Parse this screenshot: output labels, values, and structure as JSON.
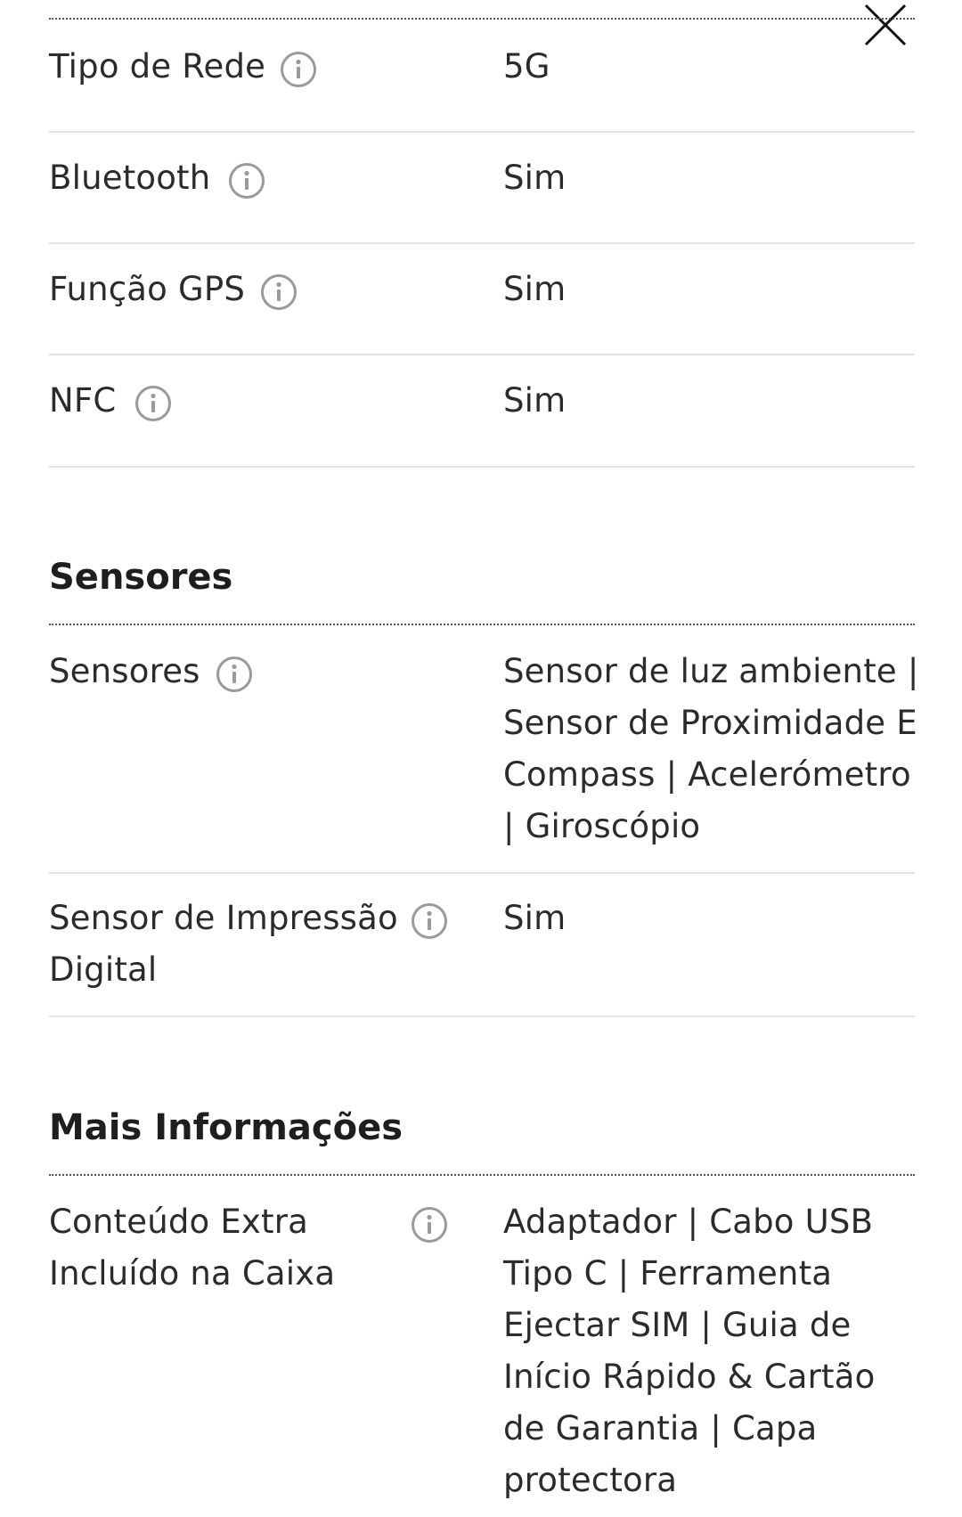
{
  "close_icon": "close-icon",
  "info_icon": "info-circle-icon",
  "connectivity_rows": [
    {
      "label": "Tipo de Rede",
      "value": "5G"
    },
    {
      "label": "Bluetooth",
      "value": "Sim"
    },
    {
      "label": "Função GPS",
      "value": "Sim"
    },
    {
      "label": "NFC",
      "value": "Sim"
    }
  ],
  "sections": {
    "sensors": {
      "title": "Sensores",
      "rows": [
        {
          "label": "Sensores",
          "value": "Sensor de luz ambiente | Sensor de Proximidade E Compass | Acelerómetro | Giroscópio"
        },
        {
          "label": "Sensor de Impressão Digital",
          "value": "Sim"
        }
      ]
    },
    "more_info": {
      "title": "Mais Informações",
      "rows": [
        {
          "label": "Conteúdo Extra Incluído na Caixa",
          "value": "Adaptador | Cabo USB Tipo C | Ferramenta Ejectar SIM | Guia de Início Rápido & Cartão de Garantia | Capa protectora"
        }
      ]
    }
  }
}
